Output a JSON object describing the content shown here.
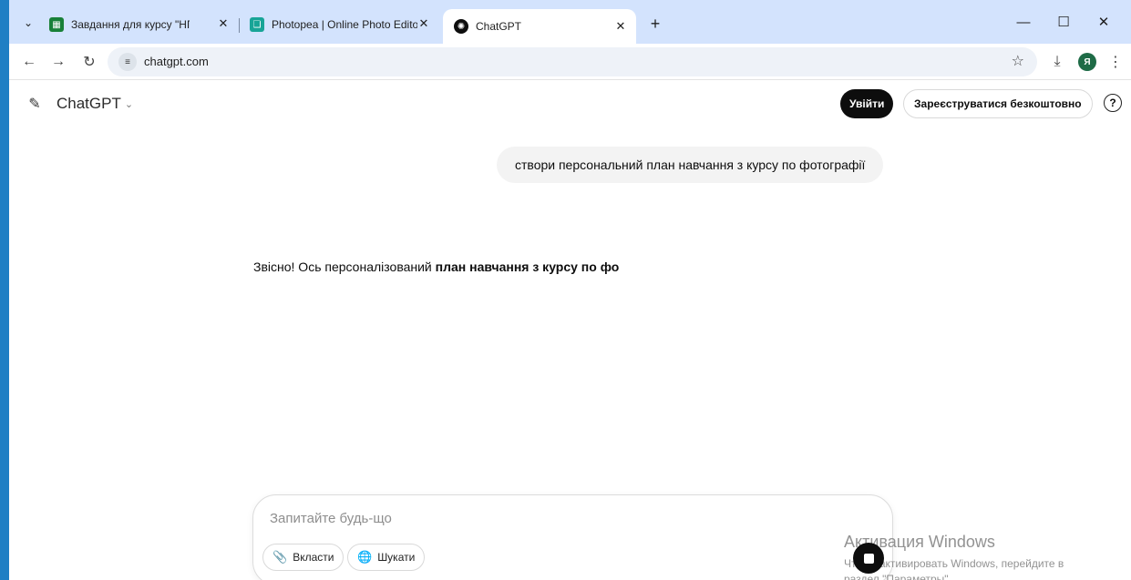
{
  "browser": {
    "tabs": [
      {
        "title": "Завдання для курсу \"НП \"Циф",
        "favicon_color": "#188038",
        "active": false
      },
      {
        "title": "Photopea | Online Photo Editor",
        "favicon_color": "#18a497",
        "active": false
      },
      {
        "title": "ChatGPT",
        "favicon_color": "#0d0d0d",
        "active": true
      }
    ],
    "address": "chatgpt.com",
    "profile_initial": "Я"
  },
  "chatgpt": {
    "model_label": "ChatGPT",
    "login_label": "Увійти",
    "signup_label": "Зареєструватися безкоштовно",
    "help_glyph": "?",
    "messages": [
      {
        "role": "user",
        "text": "створи персональний план навчання з курсу по фотографії"
      },
      {
        "role": "assistant",
        "text_plain": "Звісно! Ось персоналізований ",
        "text_bold": "план навчання з курсу по фо"
      }
    ],
    "composer": {
      "placeholder": "Запитайте будь-що",
      "attach_label": "Вкласти",
      "search_label": "Шукати"
    }
  },
  "watermark": {
    "title": "Активация Windows",
    "line1": "Чтобы активировать Windows, перейдите в",
    "line2": "раздел \"Параметры\"."
  },
  "colors": {
    "tabstrip_bg": "#d3e3fd",
    "accent_dark": "#0d0d0d",
    "user_bubble": "#f3f3f3"
  }
}
